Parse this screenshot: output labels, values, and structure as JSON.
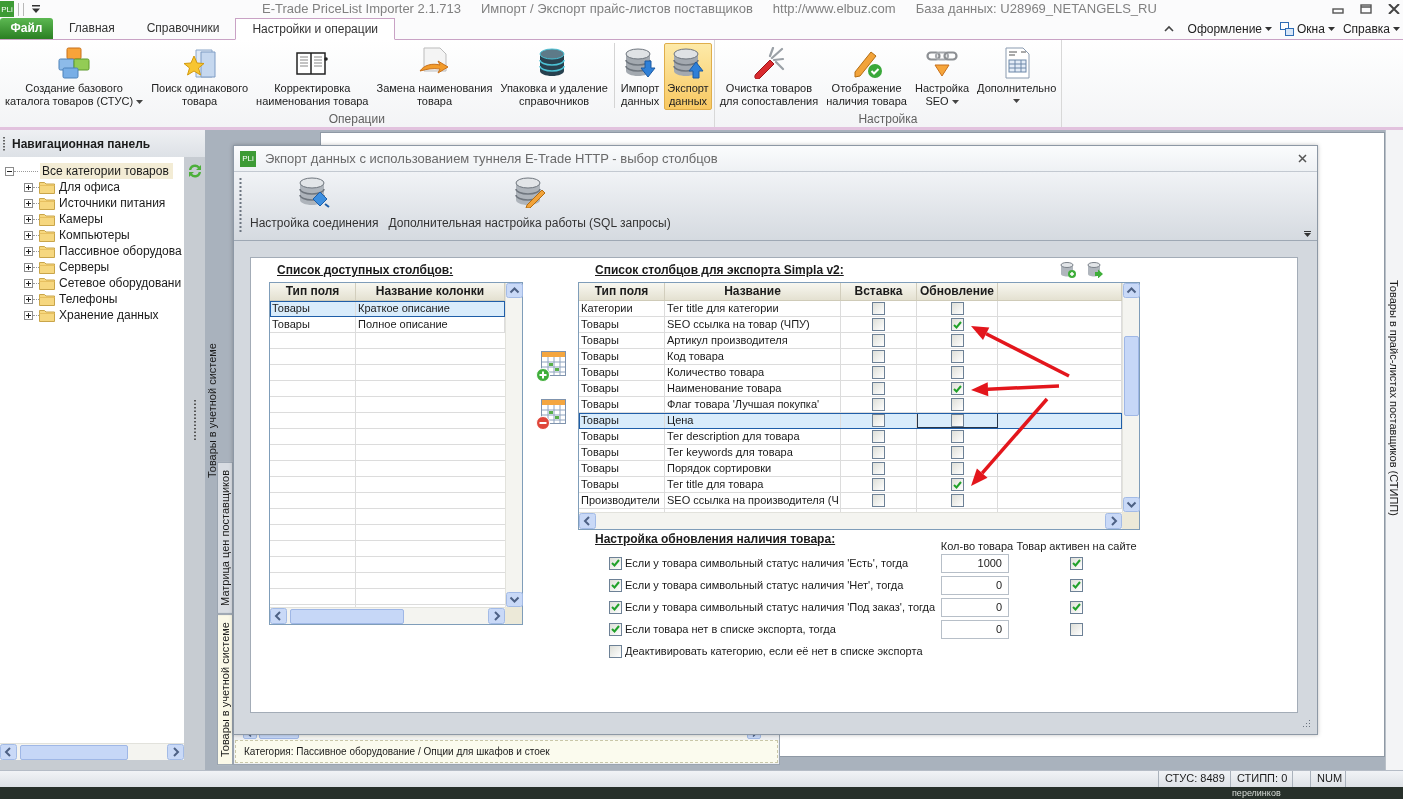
{
  "window": {
    "app_icon": "PLi",
    "title": [
      "E-Trade PriceList Importer 2.1.713",
      "Импорт / Экспорт прайс-листов поставщиков",
      "http://www.elbuz.com",
      "База данных: U28969_NETANGELS_RU"
    ]
  },
  "ribbon": {
    "tabs": [
      {
        "label": "Файл",
        "kind": "file",
        "selected": false
      },
      {
        "label": "Главная",
        "kind": "tab",
        "selected": false
      },
      {
        "label": "Справочники",
        "kind": "tab",
        "selected": false
      },
      {
        "label": "Настройки и операции",
        "kind": "tab",
        "selected": true
      }
    ],
    "menus": [
      {
        "label": "Оформление",
        "kind": "menu"
      },
      {
        "label": "Окна",
        "kind": "windows"
      },
      {
        "label": "Справка",
        "kind": "menu"
      }
    ],
    "groups": [
      {
        "label": "Операции",
        "sections": [
          [
            {
              "label": "Создание базового\nкаталога товаров (СТУС)",
              "dropdown": true,
              "pressed": false
            },
            {
              "label": "Поиск одинакового\nтовара",
              "dropdown": false,
              "pressed": false
            },
            {
              "label": "Корректировка\nнаименования товара",
              "dropdown": false,
              "pressed": false
            },
            {
              "label": "Замена наименования\nтовара",
              "dropdown": false,
              "pressed": false
            },
            {
              "label": "Упаковка и удаление\nсправочников",
              "dropdown": false,
              "pressed": false
            }
          ],
          [
            {
              "label": "Импорт\nданных",
              "dropdown": false,
              "pressed": false
            },
            {
              "label": "Экспорт\nданных",
              "dropdown": false,
              "pressed": true
            }
          ]
        ]
      },
      {
        "label": "Настройка",
        "sections": [
          [
            {
              "label": "Очистка товаров\nдля сопоставления",
              "dropdown": false,
              "pressed": false
            },
            {
              "label": "Отображение\nналичия товара",
              "dropdown": false,
              "pressed": false
            },
            {
              "label": "Настройка\nSEO",
              "dropdown": true,
              "pressed": false
            },
            {
              "label": "Дополнительно",
              "dropdown": true,
              "pressed": false
            }
          ]
        ]
      }
    ]
  },
  "navigation": {
    "title": "Навигационная панель",
    "tree": [
      {
        "label": "Все категории товаров",
        "expanded": true,
        "selected": true,
        "children": [
          {
            "label": "Для офиса",
            "expanded": false,
            "selected": false
          },
          {
            "label": "Источники питания",
            "expanded": false,
            "selected": false
          },
          {
            "label": "Камеры",
            "expanded": false,
            "selected": false
          },
          {
            "label": "Компьютеры",
            "expanded": false,
            "selected": false
          },
          {
            "label": "Пассивное оборудова",
            "expanded": false,
            "selected": false
          },
          {
            "label": "Серверы",
            "expanded": false,
            "selected": false
          },
          {
            "label": "Сетевое оборудовани",
            "expanded": false,
            "selected": false
          },
          {
            "label": "Телефоны",
            "expanded": false,
            "selected": false
          },
          {
            "label": "Хранение данных",
            "expanded": false,
            "selected": false
          }
        ]
      }
    ]
  },
  "workspace": {
    "docked_tab": {
      "label": "Товары в учетной системе"
    },
    "right_tab": {
      "label": "Товары в прайс-листах поставщиков (СТИПП)"
    },
    "child_window": {
      "tabs": [
        {
          "label": "Матрица цен поставщиков",
          "selected": false
        },
        {
          "label": "Товары в учетной системе",
          "selected": true
        }
      ],
      "status": "Категория: Пассивное оборудование / Опции для шкафов и стоек"
    },
    "dialog": {
      "icon": "PLi",
      "title": "Экпорт данных с использованием туннеля E-Trade HTTP - выбор столбцов",
      "toolbar": [
        {
          "label": "Настройка соединения"
        },
        {
          "label": "Дополнительная настройка работы (SQL запросы)"
        }
      ],
      "available_columns": {
        "title": "Список доступных столбцов:",
        "columns": [
          "Тип поля",
          "Название колонки"
        ],
        "rows": [
          {
            "cells": [
              "Товары",
              "Краткое описание"
            ],
            "selected": true
          },
          {
            "cells": [
              "Товары",
              "Полное описание"
            ],
            "selected": false
          }
        ]
      },
      "export_columns": {
        "title": "Список столбцов для экспорта Simpla v2:",
        "columns": [
          "Тип поля",
          "Название",
          "Вставка",
          "Обновление"
        ],
        "rows": [
          {
            "type": "Категории",
            "name": "Тег title для категории",
            "insert": false,
            "update": false,
            "selected": false,
            "annotated": false
          },
          {
            "type": "Товары",
            "name": "SEO ссылка на товар (ЧПУ)",
            "insert": false,
            "update": true,
            "selected": false,
            "annotated": true
          },
          {
            "type": "Товары",
            "name": "Артикул производителя",
            "insert": false,
            "update": false,
            "selected": false,
            "annotated": false
          },
          {
            "type": "Товары",
            "name": "Код товара",
            "insert": false,
            "update": false,
            "selected": false,
            "annotated": false
          },
          {
            "type": "Товары",
            "name": "Количество товара",
            "insert": false,
            "update": false,
            "selected": false,
            "annotated": false
          },
          {
            "type": "Товары",
            "name": "Наименование товара",
            "insert": false,
            "update": true,
            "selected": false,
            "annotated": true
          },
          {
            "type": "Товары",
            "name": "Флаг товара 'Лучшая покупка'",
            "insert": false,
            "update": false,
            "selected": false,
            "annotated": false
          },
          {
            "type": "Товары",
            "name": "Цена",
            "insert": false,
            "update": false,
            "selected": true,
            "annotated": false
          },
          {
            "type": "Товары",
            "name": "Тег description для товара",
            "insert": false,
            "update": false,
            "selected": false,
            "annotated": false
          },
          {
            "type": "Товары",
            "name": "Тег keywords для товара",
            "insert": false,
            "update": false,
            "selected": false,
            "annotated": false
          },
          {
            "type": "Товары",
            "name": "Порядок сортировки",
            "insert": false,
            "update": false,
            "selected": false,
            "annotated": false
          },
          {
            "type": "Товары",
            "name": "Тег title для товара",
            "insert": false,
            "update": true,
            "selected": false,
            "annotated": true
          },
          {
            "type": "Производители",
            "name": "SEO ссылка на производителя (Ч",
            "insert": false,
            "update": false,
            "selected": false,
            "annotated": false
          }
        ]
      },
      "availability": {
        "title": "Настройка обновления наличия товара:",
        "columns": [
          "Кол-во товара",
          "Товар активен на сайте"
        ],
        "rows": [
          {
            "kind": "rule",
            "label": "Если у товара символьный статус наличия 'Есть', тогда",
            "checked": true,
            "quantity": "1000",
            "active": true
          },
          {
            "kind": "rule",
            "label": "Если у товара символьный статус наличия 'Нет', тогда",
            "checked": true,
            "quantity": "0",
            "active": true
          },
          {
            "kind": "rule",
            "label": "Если у товара символьный статус наличия 'Под заказ', тогда",
            "checked": true,
            "quantity": "0",
            "active": true
          },
          {
            "kind": "rule",
            "label": "Если товара нет в списке экспорта, тогда",
            "checked": true,
            "quantity": "0",
            "active": false
          },
          {
            "kind": "option",
            "label": "Деактивировать категорию, если её нет в списке экспорта",
            "checked": false
          }
        ]
      }
    }
  },
  "status_bar": {
    "panels": [
      "СТУС: 8489",
      "СТИПП: 0",
      "NUM"
    ]
  },
  "taskbar": {
    "label": "перелинков"
  }
}
